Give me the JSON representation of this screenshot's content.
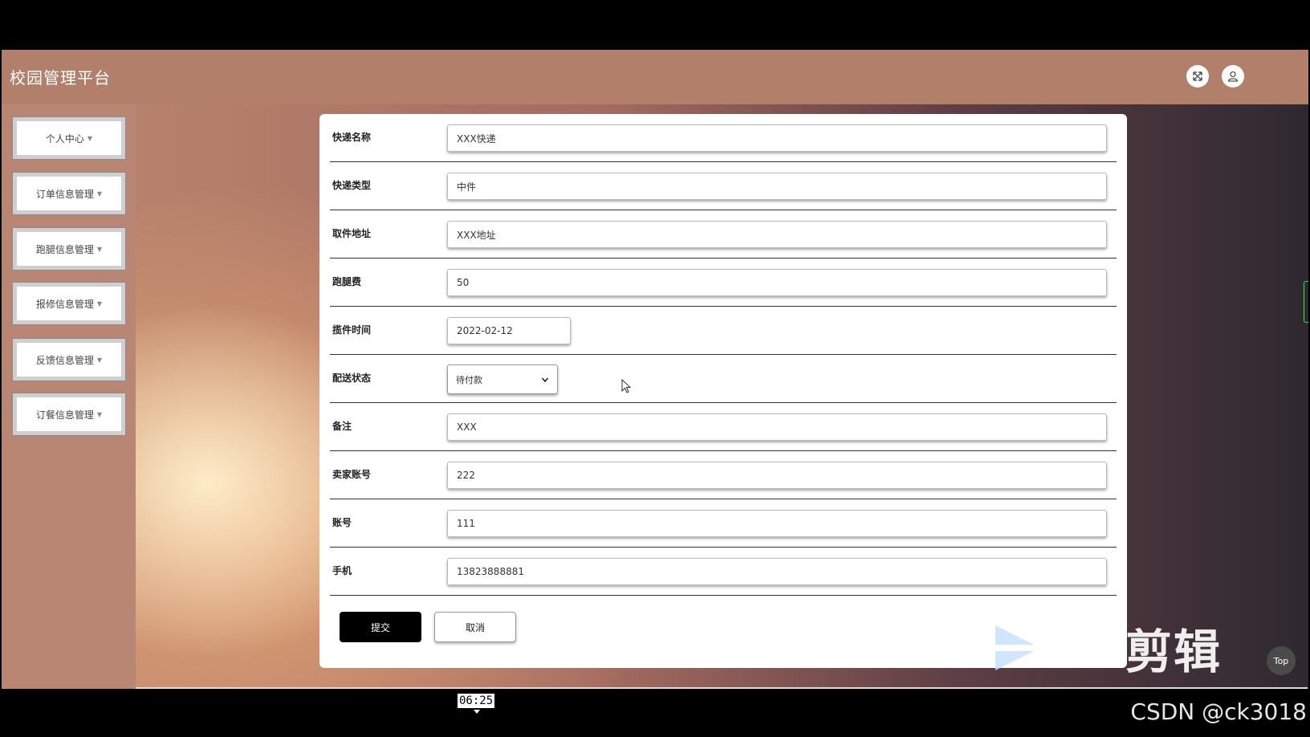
{
  "app": {
    "title": "校园管理平台"
  },
  "header_icons": [
    "fullscreen-icon",
    "user-icon"
  ],
  "sidebar": {
    "items": [
      {
        "label": "个人中心"
      },
      {
        "label": "订单信息管理"
      },
      {
        "label": "跑腿信息管理"
      },
      {
        "label": "报修信息管理"
      },
      {
        "label": "反馈信息管理"
      },
      {
        "label": "订餐信息管理"
      }
    ]
  },
  "form": {
    "fields": [
      {
        "label": "快递名称",
        "value": "XXX快递"
      },
      {
        "label": "快递类型",
        "value": "中件"
      },
      {
        "label": "取件地址",
        "value": "XXX地址"
      },
      {
        "label": "跑腿费",
        "value": "50"
      },
      {
        "label": "揽件时间",
        "value": "2022-02-12"
      },
      {
        "label": "配送状态",
        "value": "待付款"
      },
      {
        "label": "备注",
        "value": "XXX"
      },
      {
        "label": "卖家账号",
        "value": "222"
      },
      {
        "label": "账号",
        "value": "111"
      },
      {
        "label": "手机",
        "value": "13823888881"
      }
    ],
    "submit_label": "提交",
    "cancel_label": "取消"
  },
  "overlay": {
    "watermark_text": "剪辑",
    "top_button": "Top",
    "video_time": "06:25",
    "credit": "CSDN @ck3018"
  },
  "colors": {
    "header": "#b27f6a",
    "sidebar": "#b88672",
    "submit_bg": "#000000"
  }
}
